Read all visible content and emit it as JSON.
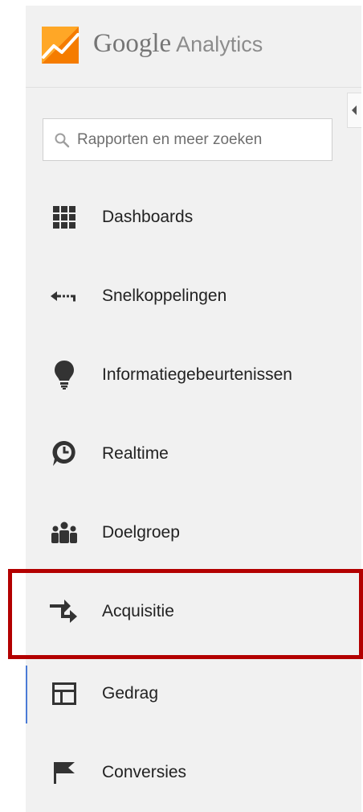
{
  "logo": {
    "google": "Google",
    "analytics": "Analytics",
    "colors": {
      "orange": "#f57c00",
      "light_orange": "#ffa726",
      "dark_orange": "#e65100"
    }
  },
  "search": {
    "placeholder": "Rapporten en meer zoeken",
    "value": ""
  },
  "nav": {
    "items": [
      {
        "label": "Dashboards",
        "icon": "grid-icon"
      },
      {
        "label": "Snelkoppelingen",
        "icon": "shortcut-arrow-icon"
      },
      {
        "label": "Informatiegebeurtenissen",
        "icon": "lightbulb-icon"
      },
      {
        "label": "Realtime",
        "icon": "clock-icon"
      },
      {
        "label": "Doelgroep",
        "icon": "people-icon"
      },
      {
        "label": "Acquisitie",
        "icon": "acquisition-arrows-icon"
      },
      {
        "label": "Gedrag",
        "icon": "layout-icon"
      },
      {
        "label": "Conversies",
        "icon": "flag-icon"
      }
    ],
    "active_item": "Gedrag",
    "highlighted_item": "Acquisitie"
  },
  "colors": {
    "sidebar_bg": "#f1f1f1",
    "icon": "#333333",
    "active_indicator": "#4b7bd6",
    "highlight_border": "#b30000"
  }
}
